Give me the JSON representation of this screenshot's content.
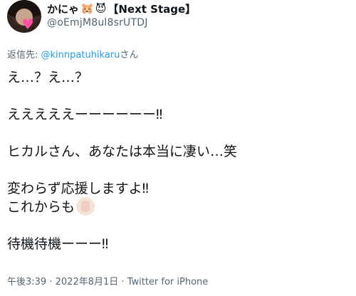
{
  "tweet": {
    "author": {
      "display_name": "かにゃ",
      "emoji_1": "🐹",
      "emoji_2": "😈",
      "name_suffix": "【Next Stage】",
      "handle": "@oEmjM8ul8srUTDJ"
    },
    "reply_to": {
      "prefix": "返信先: ",
      "mention": "@kinnpatuhikaru",
      "suffix": "さん"
    },
    "lines": [
      "え…？え…？",
      "",
      "えええええーーーーーー‼",
      "",
      "ヒカルさん、あなたは本当に凄い…笑",
      "",
      "変わらず応援しますよ‼",
      "これからも",
      "",
      "待機待機ーーー‼"
    ],
    "time": "午後3:39",
    "date": "2022年8月1日",
    "client": "Twitter for iPhone",
    "separator": "·"
  }
}
